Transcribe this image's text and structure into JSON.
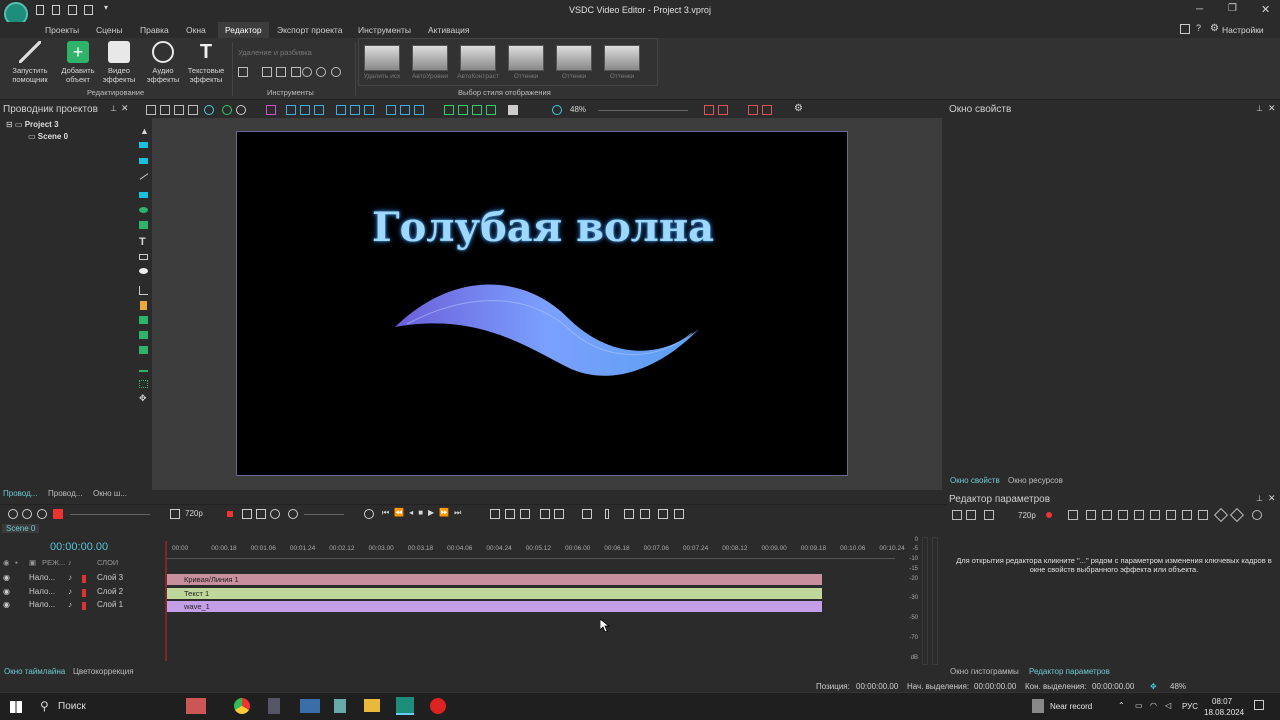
{
  "window": {
    "title": "VSDC Video Editor - Project 3.vproj",
    "settings_label": "Настройки"
  },
  "menu": [
    "Проекты",
    "Сцены",
    "Правка",
    "Окна",
    "Редактор",
    "Экспорт проекта",
    "Инструменты",
    "Активация"
  ],
  "ribbon": {
    "buttons": [
      {
        "label1": "Запустить",
        "label2": "помощник"
      },
      {
        "label1": "Добавить",
        "label2": "объект"
      },
      {
        "label1": "Видео",
        "label2": "эффекты"
      },
      {
        "label1": "Аудио",
        "label2": "эффекты"
      },
      {
        "label1": "Текстовые",
        "label2": "эффекты"
      }
    ],
    "edit_group": "Редактирование",
    "tools_group": "Инструменты",
    "tools_removal": "Удаление и разбивка",
    "style_group": "Выбор стиля отображения",
    "styles": [
      "Удалить исх",
      "АвтоУровни",
      "АвтоКонтраст",
      "Оттенки",
      "Оттенки",
      "Оттенки"
    ]
  },
  "project_explorer": {
    "title": "Проводник проектов",
    "project": "Project 3",
    "scene": "Scene 0",
    "tabs": [
      "Провод...",
      "Провод...",
      "Окно ш..."
    ]
  },
  "canvas": {
    "zoom": "48%",
    "title_text": "Голубая волна"
  },
  "properties": {
    "title": "Окно свойств",
    "tabs": [
      "Окно свойств",
      "Окно ресурсов"
    ]
  },
  "param_editor": {
    "title": "Редактор параметров",
    "resolution": "720p",
    "hint": "Для открытия редактора кликните \"...\" рядом с параметром изменения ключевых кадров в окне свойств выбранного эффекта или объекта.",
    "tabs": [
      "Окно гистограммы",
      "Редактор параметров"
    ]
  },
  "preview_bar": {
    "resolution": "720p"
  },
  "timeline": {
    "scene_tab": "Scene 0",
    "time": "00:00:00.00",
    "mode_header": "РЕЖ...",
    "layers_header": "СЛОИ",
    "ruler": [
      "00:00",
      "00:00.18",
      "00:01.06",
      "00:01.24",
      "00:02.12",
      "00:03.00",
      "00:03.18",
      "00:04.06",
      "00:04.24",
      "00:05.12",
      "00:06.00",
      "00:06.18",
      "00:07.06",
      "00:07.24",
      "00:08.12",
      "00:09.00",
      "00:09.18",
      "00:10.06",
      "00:10.24"
    ],
    "rows": [
      {
        "mode": "Нало...",
        "layer": "Слой 3",
        "clip": "Кривая/Линия 1",
        "color": "#c8909c"
      },
      {
        "mode": "Нало...",
        "layer": "Слой 2",
        "clip": "Текст 1",
        "color": "#bfd79a"
      },
      {
        "mode": "Нало...",
        "layer": "Слой 1",
        "clip": "wave_1",
        "color": "#c49ee6"
      }
    ],
    "meter": [
      "0",
      "-5",
      "-10",
      "-15",
      "-20",
      "-30",
      "-50",
      "-70",
      "dB"
    ],
    "bottom_tabs": [
      "Окно таймлайна",
      "Цветокоррекция"
    ]
  },
  "status": {
    "position_label": "Позиция:",
    "position": "00:00:00.00",
    "sel_start_label": "Нач. выделения:",
    "sel_start": "00:00:00.00",
    "sel_end_label": "Кон. выделения:",
    "sel_end": "00:00:00.00",
    "zoom": "48%"
  },
  "taskbar": {
    "search": "Поиск",
    "weather": "Near record",
    "lang": "РУС",
    "time": "08:07",
    "date": "18.08.2024"
  }
}
